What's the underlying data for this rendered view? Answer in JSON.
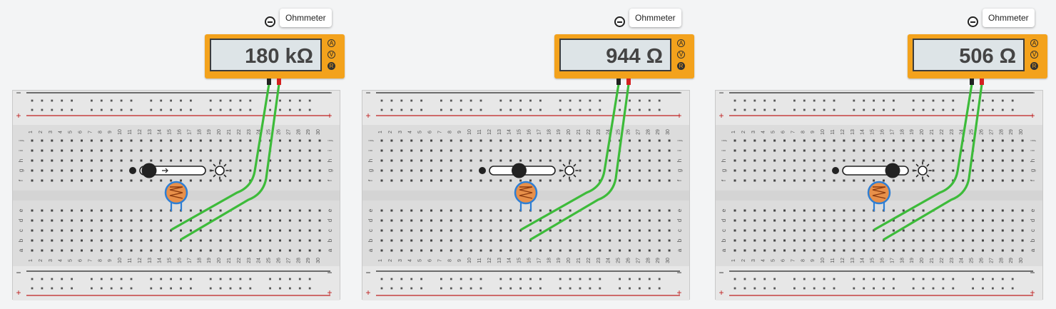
{
  "tool": {
    "label": "Ohmmeter"
  },
  "mode_buttons": [
    "A",
    "V",
    "R"
  ],
  "rail_signs": {
    "neg": "−",
    "pos": "+"
  },
  "rows": {
    "top": [
      "j",
      "i",
      "h",
      "g",
      "f"
    ],
    "bottom": [
      "e",
      "d",
      "c",
      "b",
      "a"
    ]
  },
  "columns": [
    "1",
    "2",
    "3",
    "4",
    "5",
    "6",
    "7",
    "8",
    "9",
    "10",
    "11",
    "12",
    "13",
    "14",
    "15",
    "16",
    "17",
    "18",
    "19",
    "20",
    "21",
    "22",
    "23",
    "24",
    "25",
    "26",
    "27",
    "28",
    "29",
    "30"
  ],
  "circuits": [
    {
      "reading": "180 kΩ",
      "light_level": 0.0,
      "active_mode": "R"
    },
    {
      "reading": "944 Ω",
      "light_level": 0.5,
      "active_mode": "R"
    },
    {
      "reading": "506 Ω",
      "light_level": 1.0,
      "active_mode": "R"
    }
  ],
  "colors": {
    "meter": "#f3a21c",
    "probe_neg": "#222222",
    "probe_pos": "#d42020",
    "wire": "#3dbb3a",
    "rail_red": "#c02020",
    "photoresistor": "#e8904a"
  }
}
